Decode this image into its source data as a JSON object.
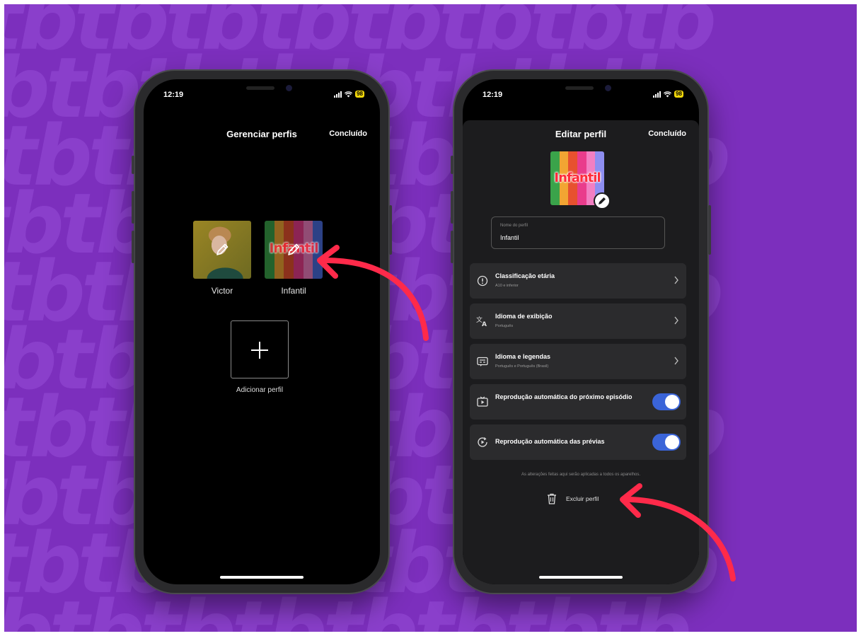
{
  "colors": {
    "background": "#7c2fbd",
    "arrow": "#ff2a4a",
    "toggle_on": "#3a64d8",
    "infantil_text": "#ff2a3a"
  },
  "watermark": "tbtbtbtbtbtbtbtb",
  "left_phone": {
    "status": {
      "time": "12:19",
      "battery": "98"
    },
    "header": {
      "title": "Gerenciar perfis",
      "done": "Concluído"
    },
    "profiles": [
      {
        "name": "Victor",
        "icon": "pencil-icon"
      },
      {
        "name": "Infantil",
        "image_text": "Infantil",
        "icon": "pencil-icon"
      }
    ],
    "add_profile": {
      "label": "Adicionar perfil",
      "icon": "plus-icon"
    }
  },
  "right_phone": {
    "status": {
      "time": "12:19",
      "battery": "98"
    },
    "header": {
      "title": "Editar perfil",
      "done": "Concluído"
    },
    "avatar": {
      "image_text": "Infantil",
      "icon": "pencil-icon"
    },
    "name_field": {
      "label": "Nome do perfil",
      "value": "Infantil"
    },
    "settings": [
      {
        "title": "Classificação etária",
        "subtitle": "A10 e inferior",
        "icon": "rating-icon",
        "control": "chevron"
      },
      {
        "title": "Idioma de exibição",
        "subtitle": "Português",
        "icon": "translate-icon",
        "control": "chevron"
      },
      {
        "title": "Idioma e legendas",
        "subtitle": "Português e Português (Brasil)",
        "icon": "subtitles-icon",
        "control": "chevron"
      },
      {
        "title": "Reprodução automática do próximo episódio",
        "subtitle": "",
        "icon": "autoplay-icon",
        "control": "toggle",
        "on": true
      },
      {
        "title": "Reprodução automática das prévias",
        "subtitle": "",
        "icon": "preview-icon",
        "control": "toggle",
        "on": true
      }
    ],
    "footnote": "As alterações feitas aqui serão aplicadas a todos os aparelhos.",
    "delete": {
      "label": "Excluir perfil",
      "icon": "trash-icon"
    }
  }
}
